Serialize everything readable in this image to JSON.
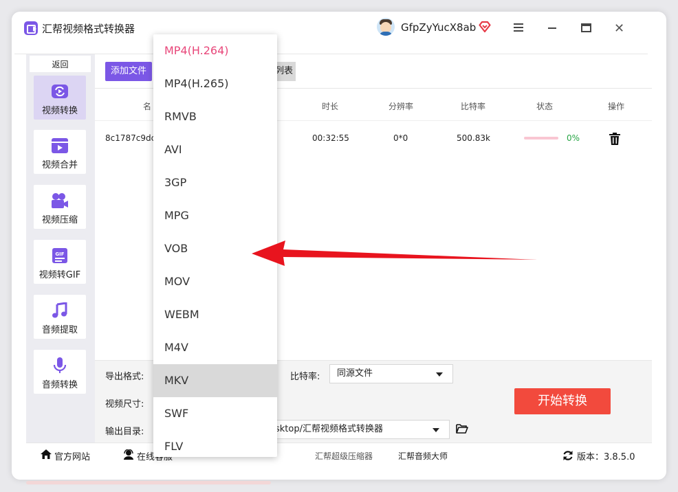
{
  "app": {
    "title": "汇帮视频格式转换器",
    "username": "GfpZyYucX8ab"
  },
  "sidebar": {
    "back": "返回",
    "items": [
      {
        "label": "视频转换",
        "icon": "video-convert-icon"
      },
      {
        "label": "视频合并",
        "icon": "video-merge-icon"
      },
      {
        "label": "视频压缩",
        "icon": "video-compress-icon"
      },
      {
        "label": "视频转GIF",
        "icon": "gif-icon"
      },
      {
        "label": "音频提取",
        "icon": "music-icon"
      },
      {
        "label": "音频转换",
        "icon": "microphone-icon"
      }
    ]
  },
  "toolbar": {
    "add_file": "添加文件",
    "list_suffix": "列表"
  },
  "table": {
    "headers": {
      "name": "名",
      "duration": "时长",
      "resolution": "分辨率",
      "bitrate": "比特率",
      "status": "状态",
      "action": "操作"
    },
    "rows": [
      {
        "name": "8c1787c9dca",
        "duration": "00:32:55",
        "resolution": "0*0",
        "bitrate": "500.83k",
        "progress": 0,
        "percent": "0%"
      }
    ]
  },
  "settings": {
    "export_format_label": "导出格式:",
    "video_size_label": "视频尺寸:",
    "output_dir_label": "输出目录:",
    "bitrate_label": "比特率:",
    "bitrate_value": "同源文件",
    "output_dir_value": "sktop/汇帮视频格式转换器",
    "start_button": "开始转换"
  },
  "footer": {
    "website": "官方网站",
    "service": "在线客服",
    "link1": "汇帮超级压缩器",
    "link2": "汇帮音频大师",
    "version": "版本：3.8.5.0"
  },
  "dropdown": {
    "options": [
      "MP4(H.264)",
      "MP4(H.265)",
      "RMVB",
      "AVI",
      "3GP",
      "MPG",
      "VOB",
      "MOV",
      "WEBM",
      "M4V",
      "MKV",
      "SWF",
      "FLV"
    ],
    "selected": "MP4(H.264)",
    "hovered": "MKV"
  },
  "colors": {
    "accent": "#7b57e6",
    "start": "#f24a3d",
    "selected_option": "#e8477a",
    "arrow": "#e8141e",
    "progress_text": "#26a544"
  }
}
